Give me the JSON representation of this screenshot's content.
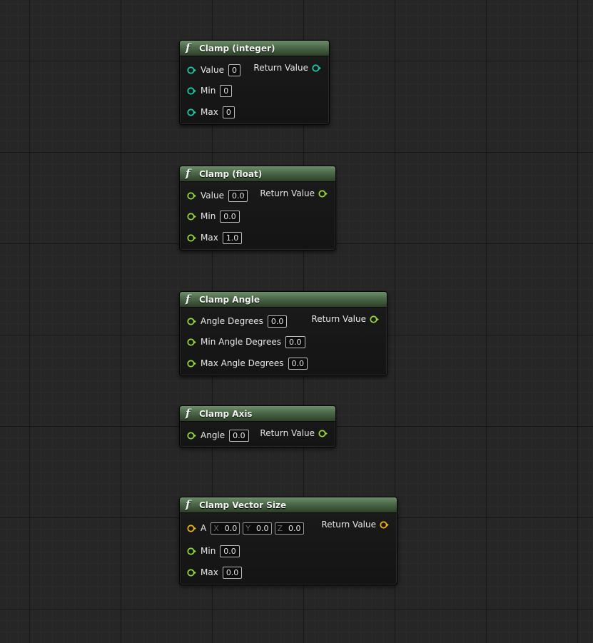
{
  "nodes": {
    "clamp_int": {
      "icon": "function-icon",
      "icon_glyph": "f",
      "title": "Clamp (integer)",
      "pin_color": "#1dc7a8",
      "return_label": "Return Value",
      "inputs": [
        {
          "label": "Value",
          "value": "0"
        },
        {
          "label": "Min",
          "value": "0"
        },
        {
          "label": "Max",
          "value": "0"
        }
      ]
    },
    "clamp_float": {
      "icon": "function-icon",
      "icon_glyph": "f",
      "title": "Clamp (float)",
      "pin_color": "#8ed63a",
      "return_label": "Return Value",
      "inputs": [
        {
          "label": "Value",
          "value": "0.0"
        },
        {
          "label": "Min",
          "value": "0.0"
        },
        {
          "label": "Max",
          "value": "1.0"
        }
      ]
    },
    "clamp_angle": {
      "icon": "function-icon",
      "icon_glyph": "f",
      "title": "Clamp Angle",
      "pin_color": "#8ed63a",
      "return_label": "Return Value",
      "inputs": [
        {
          "label": "Angle Degrees",
          "value": "0.0"
        },
        {
          "label": "Min Angle Degrees",
          "value": "0.0"
        },
        {
          "label": "Max Angle Degrees",
          "value": "0.0"
        }
      ]
    },
    "clamp_axis": {
      "icon": "function-icon",
      "icon_glyph": "f",
      "title": "Clamp Axis",
      "pin_color": "#8ed63a",
      "return_label": "Return Value",
      "inputs": [
        {
          "label": "Angle",
          "value": "0.0"
        }
      ]
    },
    "clamp_vector_size": {
      "icon": "function-icon",
      "icon_glyph": "f",
      "title": "Clamp Vector Size",
      "vector_pin_color": "#f0b118",
      "float_pin_color": "#8ed63a",
      "return_label": "Return Value",
      "vector_input": {
        "label": "A",
        "x_label": "X",
        "x_value": "0.0",
        "y_label": "Y",
        "y_value": "0.0",
        "z_label": "Z",
        "z_value": "0.0"
      },
      "inputs": [
        {
          "label": "Min",
          "value": "0.0"
        },
        {
          "label": "Max",
          "value": "0.0"
        }
      ]
    }
  }
}
